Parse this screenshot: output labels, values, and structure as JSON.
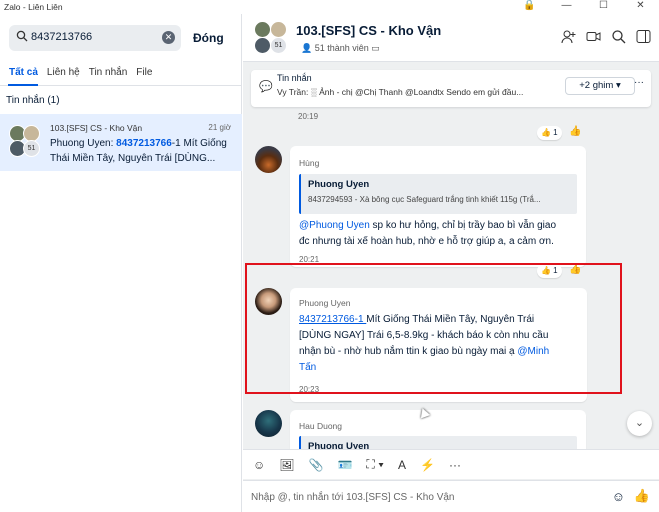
{
  "window": {
    "title": "Zalo - Liên Liên"
  },
  "search": {
    "value": "8437213766",
    "close_label": "Đóng"
  },
  "tabs": [
    {
      "label": "Tất cả"
    },
    {
      "label": "Liên hệ"
    },
    {
      "label": "Tin nhắn"
    },
    {
      "label": "File"
    }
  ],
  "section": {
    "label": "Tin nhắn (1)"
  },
  "result": {
    "group_name": "103.[SFS] CS - Kho Vận",
    "time": "21 giờ",
    "author": "Phuong Uyen: ",
    "highlight": "8437213766",
    "rest": "-1 Mít Giống Thái Miền Tây, Nguyên Trái [DÙNG...",
    "badge": "51"
  },
  "chat": {
    "title": "103.[SFS] CS - Kho Vận",
    "members": "51 thành viên",
    "badge": "51"
  },
  "pinned": {
    "label": "Tin nhắn",
    "text": "Vy Trần: ░ Ảnh - chị @Chị Thanh @Loandtx Sendo em gửi đầu...",
    "button": "+2 ghim",
    "more": "···"
  },
  "messages": {
    "prev_time": "20:19",
    "prev_react": "👍 1",
    "m1": {
      "sender": "Hùng",
      "quote_name": "Phuong Uyen",
      "quote_text": "8437294593 - Xà bông cục Safeguard trắng tinh khiết 115g (Trắ...",
      "mention": "@Phuong Uyen",
      "text1": " sp ko hư hỏng, chỉ bị trầy bao bì vẫn giao",
      "text2": "đc nhưng tài xế hoàn hub, nhờ e hỗ trợ giúp a, a cảm ơn.",
      "time": "20:21",
      "react": "👍 1"
    },
    "m2": {
      "sender": "Phuong Uyen",
      "link": "8437213766-1 ",
      "line1": "Mít Giống Thái Miền Tây, Nguyên Trái",
      "line2": "[DÙNG NGAY] Trái 6,5-8.9kg - khách báo k còn nhu cầu",
      "line3": "nhận bù - nhờ hub nắm ttin k giao bù ngày mai ạ ",
      "mention_a": "@Minh",
      "mention_b": "Tấn",
      "time": "20:23"
    },
    "m3": {
      "sender": "Hau Duong",
      "quote_name": "Phuong Uyen"
    }
  },
  "composer": {
    "placeholder": "Nhập @, tin nhắn tới 103.[SFS] CS - Kho Vận"
  }
}
